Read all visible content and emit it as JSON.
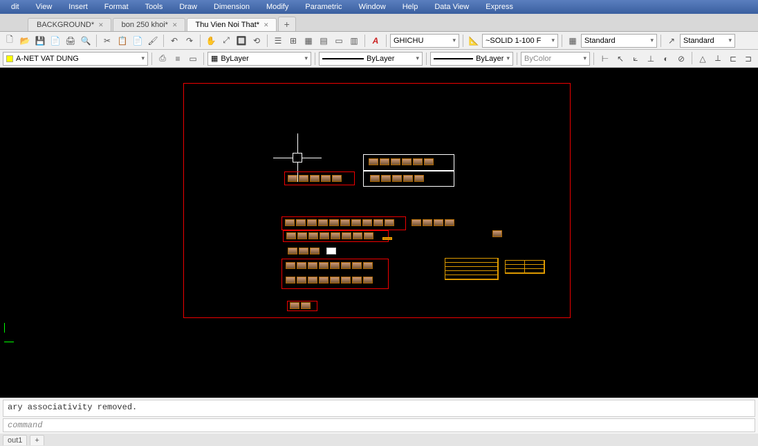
{
  "menu": [
    "dit",
    "View",
    "Insert",
    "Format",
    "Tools",
    "Draw",
    "Dimension",
    "Modify",
    "Parametric",
    "Window",
    "Help",
    "Data View",
    "Express"
  ],
  "tabs": [
    {
      "label": "BACKGROUND*",
      "active": false
    },
    {
      "label": "bon 250 khoi*",
      "active": false
    },
    {
      "label": "Thu Vien Noi That*",
      "active": true
    }
  ],
  "toolbar1": {
    "textstyle_combo": "GHICHU",
    "dimstyle_combo": "~SOLID 1-100 F",
    "std_combo1": "Standard",
    "std_combo2": "Standard"
  },
  "toolbar2": {
    "layer": "A-NET VAT DUNG",
    "linetype_combo": "ByLayer",
    "lineweight_combo": "ByLayer",
    "linetype2_combo": "ByLayer",
    "color_combo": "ByColor"
  },
  "command": {
    "history": "ary associativity removed.",
    "prompt": "command"
  },
  "layout_tabs": [
    "out1",
    "+"
  ]
}
